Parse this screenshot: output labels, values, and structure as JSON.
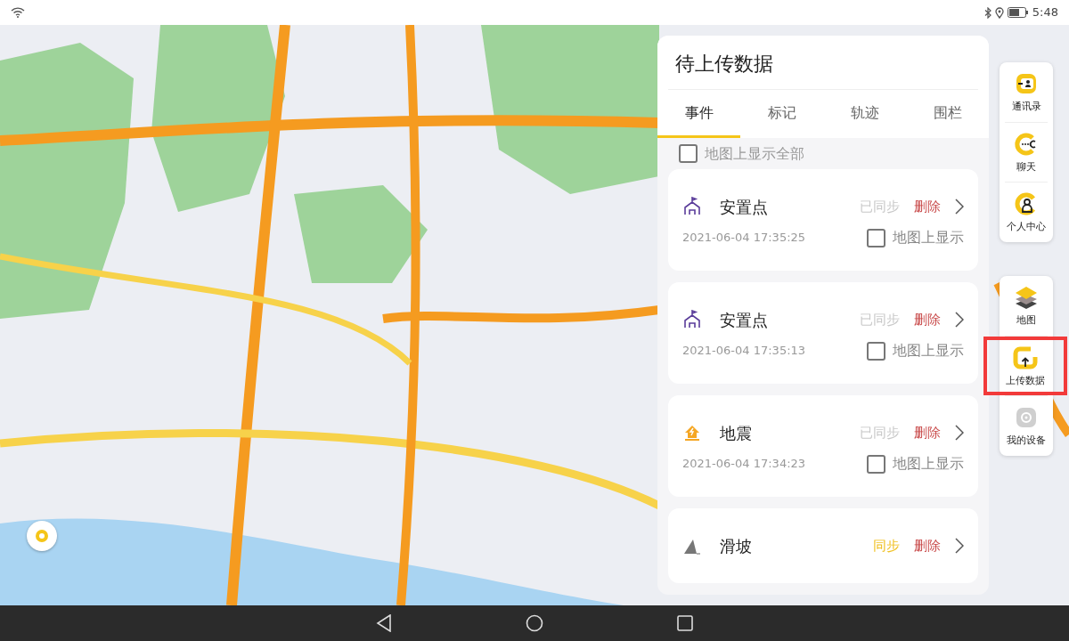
{
  "status_bar": {
    "time": "5:48"
  },
  "panel": {
    "title": "待上传数据",
    "tabs": [
      {
        "label": "事件",
        "selected": true
      },
      {
        "label": "标记",
        "selected": false
      },
      {
        "label": "轨迹",
        "selected": false
      },
      {
        "label": "围栏",
        "selected": false
      }
    ],
    "show_all": {
      "label": "地图上显示全部",
      "checked": false
    },
    "items": [
      {
        "kind": "shelter",
        "name": "安置点",
        "sync": "已同步",
        "synced": true,
        "delete": "删除",
        "time": "2021-06-04 17:35:25",
        "show_label": "地图上显示",
        "checked": false
      },
      {
        "kind": "shelter",
        "name": "安置点",
        "sync": "已同步",
        "synced": true,
        "delete": "删除",
        "time": "2021-06-04 17:35:13",
        "show_label": "地图上显示",
        "checked": false
      },
      {
        "kind": "earthquake",
        "name": "地震",
        "sync": "已同步",
        "synced": true,
        "delete": "删除",
        "time": "2021-06-04 17:34:23",
        "show_label": "地图上显示",
        "checked": false
      },
      {
        "kind": "landslide",
        "name": "滑坡",
        "sync": "同步",
        "synced": false,
        "delete": "删除"
      }
    ]
  },
  "sidebar": [
    [
      {
        "kind": "contacts",
        "label": "通讯录",
        "highlighted": false
      },
      {
        "kind": "chat",
        "label": "聊天",
        "highlighted": false
      },
      {
        "kind": "profile",
        "label": "个人中心",
        "highlighted": false
      }
    ],
    [
      {
        "kind": "layers",
        "label": "地图",
        "highlighted": false
      },
      {
        "kind": "upload",
        "label": "上传数据",
        "highlighted": true
      },
      {
        "kind": "device",
        "label": "我的设备",
        "highlighted": false
      }
    ]
  ]
}
